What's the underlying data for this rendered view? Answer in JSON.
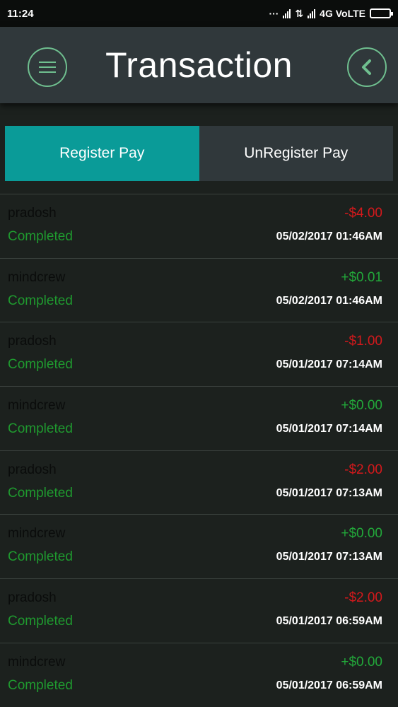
{
  "status_bar": {
    "time": "11:24",
    "network": "4G VoLTE"
  },
  "header": {
    "title": "Transaction",
    "menu_icon": "hamburger-menu-icon",
    "back_icon": "chevron-left-icon"
  },
  "tabs": [
    {
      "label": "Register Pay",
      "active": true
    },
    {
      "label": "UnRegister Pay",
      "active": false
    }
  ],
  "colors": {
    "accent_tab": "#0a9b98",
    "negative": "#d4191c",
    "positive": "#22a83a",
    "status_completed": "#1f9a2f"
  },
  "transactions": [
    {
      "name": "pradosh",
      "amount": "-$4.00",
      "sign": "neg",
      "status": "Completed",
      "datetime": "05/02/2017 01:46AM"
    },
    {
      "name": "mindcrew",
      "amount": "+$0.01",
      "sign": "pos",
      "status": "Completed",
      "datetime": "05/02/2017 01:46AM"
    },
    {
      "name": "pradosh",
      "amount": "-$1.00",
      "sign": "neg",
      "status": "Completed",
      "datetime": "05/01/2017 07:14AM"
    },
    {
      "name": "mindcrew",
      "amount": "+$0.00",
      "sign": "pos",
      "status": "Completed",
      "datetime": "05/01/2017 07:14AM"
    },
    {
      "name": "pradosh",
      "amount": "-$2.00",
      "sign": "neg",
      "status": "Completed",
      "datetime": "05/01/2017 07:13AM"
    },
    {
      "name": "mindcrew",
      "amount": "+$0.00",
      "sign": "pos",
      "status": "Completed",
      "datetime": "05/01/2017 07:13AM"
    },
    {
      "name": "pradosh",
      "amount": "-$2.00",
      "sign": "neg",
      "status": "Completed",
      "datetime": "05/01/2017 06:59AM"
    },
    {
      "name": "mindcrew",
      "amount": "+$0.00",
      "sign": "pos",
      "status": "Completed",
      "datetime": "05/01/2017 06:59AM"
    }
  ]
}
